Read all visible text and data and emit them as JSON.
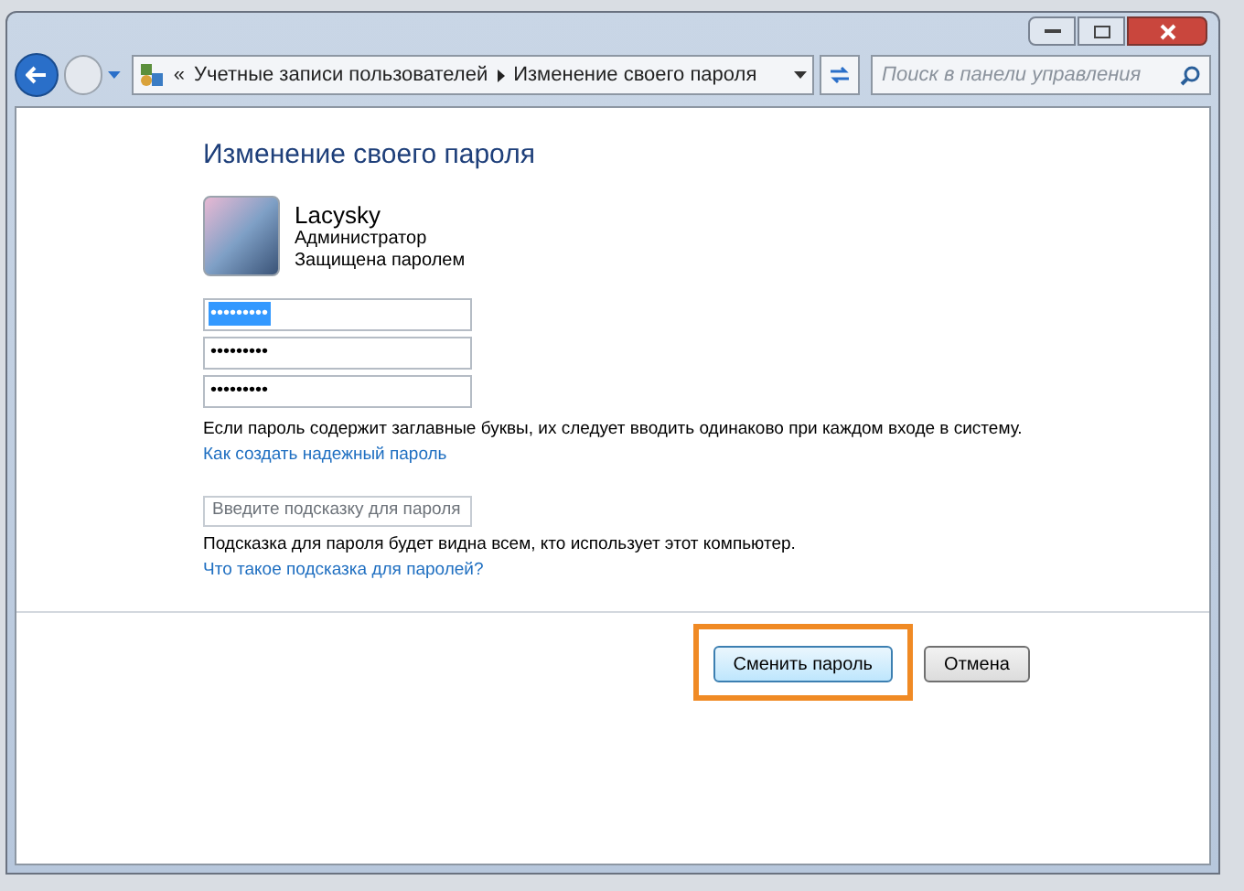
{
  "breadcrumb": {
    "overflow": "«",
    "items": [
      "Учетные записи пользователей",
      "Изменение своего пароля"
    ]
  },
  "search": {
    "placeholder": "Поиск в панели управления"
  },
  "heading": "Изменение своего пароля",
  "user": {
    "name": "Lacysky",
    "role": "Администратор",
    "status": "Защищена паролем"
  },
  "password_fields": [
    {
      "value": "•••••••••",
      "selected": true
    },
    {
      "value": "•••••••••",
      "selected": false
    },
    {
      "value": "•••••••••",
      "selected": false
    }
  ],
  "caps_note": "Если пароль содержит заглавные буквы, их следует вводить одинаково при каждом входе в систему.",
  "strong_link": "Как создать надежный пароль",
  "hint": {
    "placeholder": "Введите подсказку для пароля"
  },
  "hint_note": "Подсказка для пароля будет видна всем, кто использует этот компьютер.",
  "hint_link": "Что такое подсказка для паролей?",
  "buttons": [
    {
      "label": "Сменить пароль",
      "highlighted": true
    },
    {
      "label": "Отмена",
      "highlighted": false
    }
  ]
}
